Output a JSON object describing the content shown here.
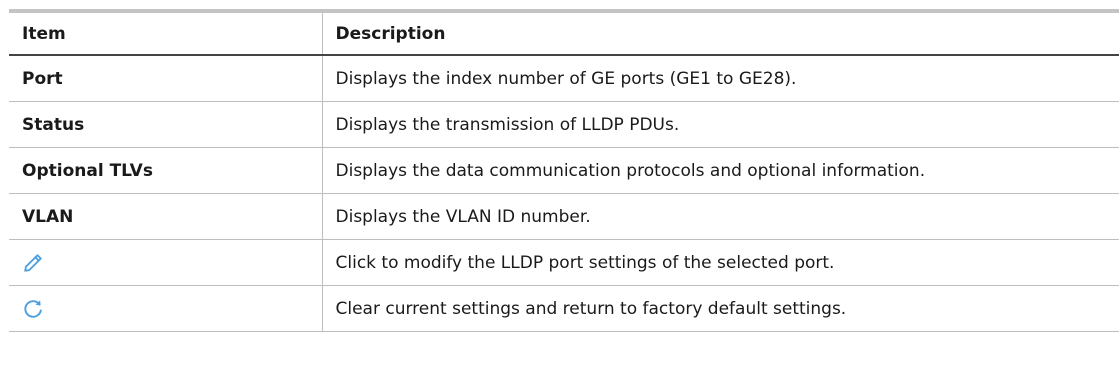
{
  "table": {
    "headers": {
      "item": "Item",
      "description": "Description"
    },
    "rows": [
      {
        "item": "Port",
        "description": "Displays the index number of GE ports (GE1 to GE28)."
      },
      {
        "item": "Status",
        "description": "Displays the transmission of LLDP PDUs."
      },
      {
        "item": "Optional TLVs",
        "description": "Displays the data communication protocols and optional information."
      },
      {
        "item": "VLAN",
        "description": "Displays the VLAN ID number."
      },
      {
        "item_icon": "edit-pencil-icon",
        "description": "Click to modify the LLDP port settings of the selected port."
      },
      {
        "item_icon": "refresh-icon",
        "description": "Clear current settings and return to factory default settings."
      }
    ]
  },
  "colors": {
    "icon_blue": "#4a9fe0",
    "top_rule": "#c4c4c4",
    "header_rule": "#444444",
    "grid_line": "#bdbdbd"
  }
}
